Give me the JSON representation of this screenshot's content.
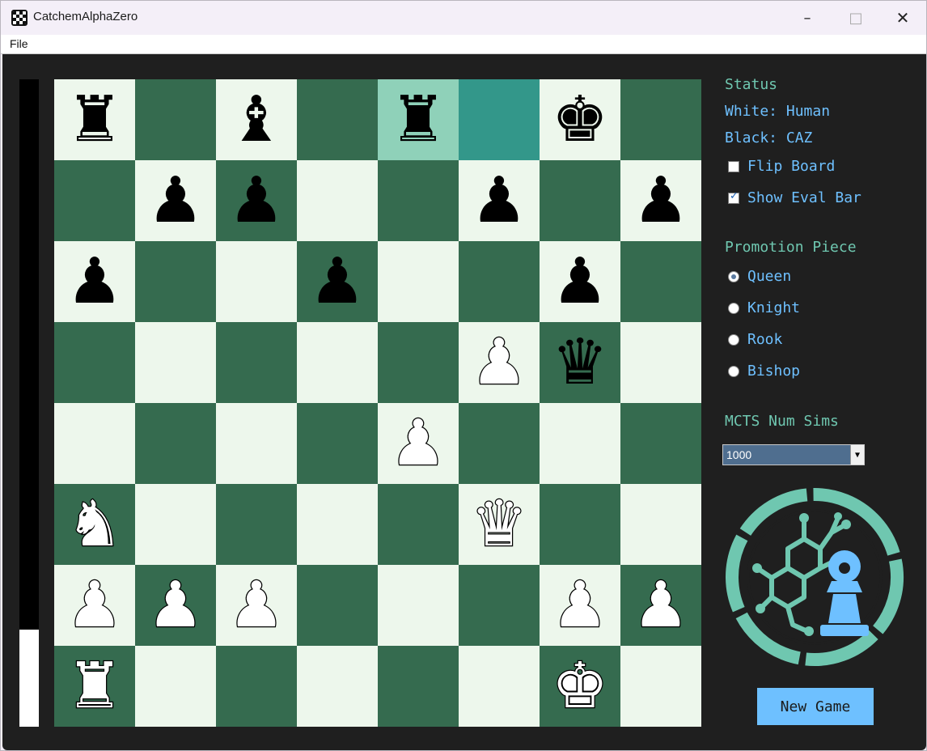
{
  "window": {
    "title": "CatchemAlphaZero"
  },
  "menu": {
    "file": "File"
  },
  "eval": {
    "white_fraction": 0.15
  },
  "board": {
    "light_color": "#edf7ec",
    "dark_color": "#356b4f",
    "last_move": {
      "from": "e8",
      "to": "f8"
    },
    "squares": [
      [
        "bR",
        "",
        "bB",
        "",
        "bR",
        "",
        "bK",
        ""
      ],
      [
        "",
        "bP",
        "bP",
        "",
        "",
        "bP",
        "",
        "bP"
      ],
      [
        "bP",
        "",
        "",
        "bP",
        "",
        "",
        "bP",
        ""
      ],
      [
        "",
        "",
        "",
        "",
        "",
        "wP",
        "bQ",
        ""
      ],
      [
        "",
        "",
        "",
        "",
        "wP",
        "",
        "",
        ""
      ],
      [
        "wN",
        "",
        "",
        "",
        "",
        "wQ",
        "",
        ""
      ],
      [
        "wP",
        "wP",
        "wP",
        "",
        "",
        "",
        "wP",
        "wP"
      ],
      [
        "wR",
        "",
        "",
        "",
        "",
        "",
        "wK",
        ""
      ]
    ]
  },
  "panel": {
    "status_heading": "Status",
    "white_player": "White: Human",
    "black_player": "Black: CAZ",
    "flip_board": {
      "label": "Flip Board",
      "checked": false
    },
    "show_eval": {
      "label": "Show Eval Bar",
      "checked": true
    },
    "promotion_heading": "Promotion Piece",
    "promotion_options": [
      {
        "label": "Queen",
        "checked": true
      },
      {
        "label": "Knight",
        "checked": false
      },
      {
        "label": "Rook",
        "checked": false
      },
      {
        "label": "Bishop",
        "checked": false
      }
    ],
    "mcts_heading": "MCTS Num Sims",
    "mcts_value": "1000",
    "new_game_label": "New Game"
  },
  "colors": {
    "accent_teal": "#6fc7b0",
    "accent_blue": "#6ec0ff",
    "background": "#1f1f1f"
  }
}
